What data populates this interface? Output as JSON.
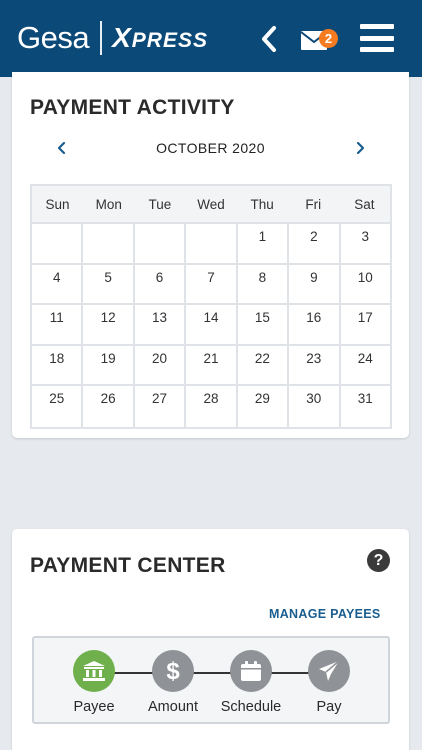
{
  "header": {
    "brand_gesa": "Gesa",
    "brand_x": "X",
    "brand_press": "PRESS",
    "mail_badge_count": "2",
    "icons": {
      "back": "chevron-left-icon",
      "mail": "mail-icon",
      "menu": "hamburger-menu-icon"
    },
    "colors": {
      "background": "#0b4a78",
      "accent": "#f47b20"
    }
  },
  "activity": {
    "title": "PAYMENT ACTIVITY",
    "month": "OCTOBER 2020",
    "weekdays": [
      "Sun",
      "Mon",
      "Tue",
      "Wed",
      "Thu",
      "Fri",
      "Sat"
    ],
    "weeks": [
      [
        "",
        "",
        "",
        "",
        "1",
        "2",
        "3"
      ],
      [
        "4",
        "5",
        "6",
        "7",
        "8",
        "9",
        "10"
      ],
      [
        "11",
        "12",
        "13",
        "14",
        "15",
        "16",
        "17"
      ],
      [
        "18",
        "19",
        "20",
        "21",
        "22",
        "23",
        "24"
      ],
      [
        "25",
        "26",
        "27",
        "28",
        "29",
        "30",
        "31"
      ]
    ]
  },
  "center": {
    "title": "PAYMENT CENTER",
    "help": "?",
    "manage_payees": "MANAGE PAYEES",
    "steps": [
      {
        "label": "Payee",
        "icon": "bank-icon",
        "active": true
      },
      {
        "label": "Amount",
        "icon": "dollar-icon",
        "active": false
      },
      {
        "label": "Schedule",
        "icon": "calendar-icon",
        "active": false
      },
      {
        "label": "Pay",
        "icon": "paper-plane-icon",
        "active": false
      }
    ],
    "colors": {
      "active_step": "#6fb04c",
      "inactive_step": "#8f9296",
      "link": "#1a5e8f"
    }
  }
}
